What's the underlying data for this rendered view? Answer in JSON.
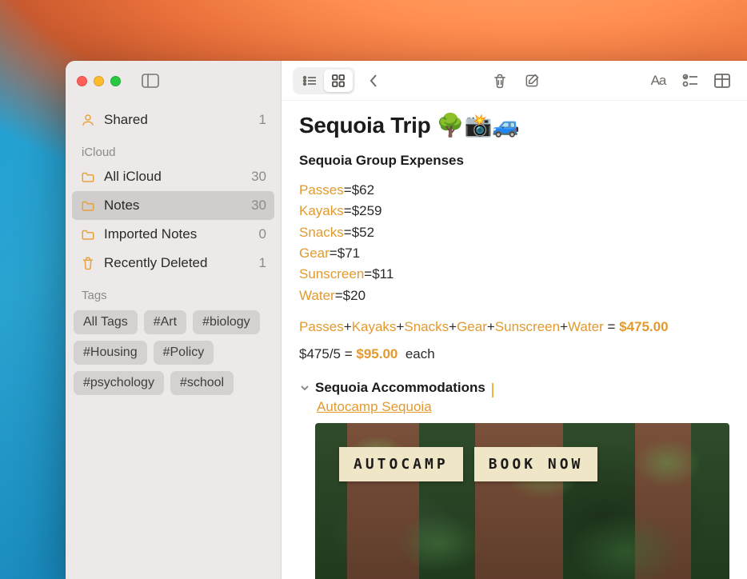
{
  "sidebar": {
    "shared": {
      "label": "Shared",
      "count": "1"
    },
    "sections": {
      "icloud": "iCloud",
      "tags": "Tags"
    },
    "folders": [
      {
        "label": "All iCloud",
        "count": "30",
        "icon": "folder"
      },
      {
        "label": "Notes",
        "count": "30",
        "icon": "folder",
        "selected": true
      },
      {
        "label": "Imported Notes",
        "count": "0",
        "icon": "folder"
      },
      {
        "label": "Recently Deleted",
        "count": "1",
        "icon": "trash"
      }
    ],
    "tags": [
      "All Tags",
      "#Art",
      "#biology",
      "#Housing",
      "#Policy",
      "#psychology",
      "#school"
    ]
  },
  "note": {
    "title": "Sequoia Trip 🌳📸🚙",
    "subheading": "Sequoia Group Expenses",
    "expenses": [
      {
        "k": "Passes",
        "v": "$62"
      },
      {
        "k": "Kayaks",
        "v": "$259"
      },
      {
        "k": "Snacks",
        "v": "$52"
      },
      {
        "k": "Gear",
        "v": "$71"
      },
      {
        "k": "Sunscreen",
        "v": "$11"
      },
      {
        "k": "Water",
        "v": "$20"
      }
    ],
    "sum": {
      "terms": [
        "Passes",
        "Kayaks",
        "Snacks",
        "Gear",
        "Sunscreen",
        "Water"
      ],
      "total": "$475.00"
    },
    "each": {
      "lhs": "$475/5",
      "val": "$95.00",
      "suffix": "each"
    },
    "accommodations": {
      "heading": "Sequoia Accommodations",
      "link": "Autocamp Sequoia"
    },
    "preview": {
      "pill1": "AUTOCAMP",
      "pill2": "BOOK NOW"
    }
  }
}
